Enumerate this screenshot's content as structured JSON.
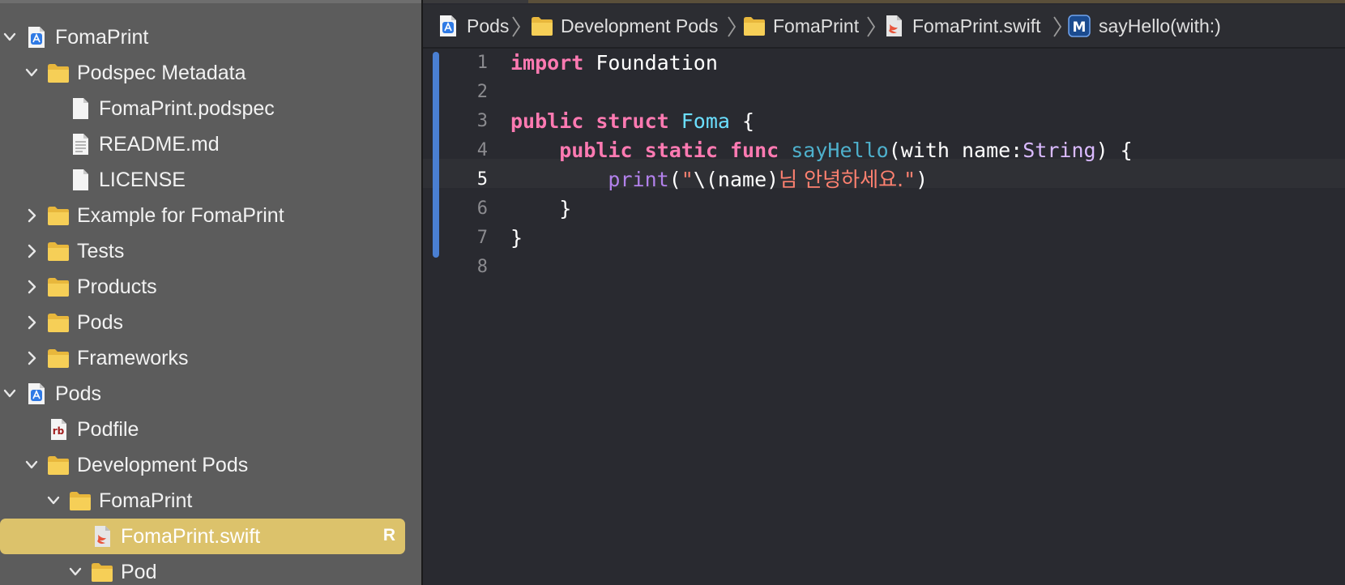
{
  "navigator": {
    "items": [
      {
        "label": "FomaPrint",
        "level": 0,
        "expanded": true,
        "icon": "xcode-project-icon"
      },
      {
        "label": "Podspec Metadata",
        "level": 1,
        "expanded": true,
        "icon": "folder-icon"
      },
      {
        "label": "FomaPrint.podspec",
        "level": 2,
        "icon": "file-icon"
      },
      {
        "label": "README.md",
        "level": 2,
        "icon": "text-file-icon"
      },
      {
        "label": "LICENSE",
        "level": 2,
        "icon": "file-icon"
      },
      {
        "label": "Example for FomaPrint",
        "level": 1,
        "expanded": false,
        "icon": "folder-icon"
      },
      {
        "label": "Tests",
        "level": 1,
        "expanded": false,
        "icon": "folder-icon"
      },
      {
        "label": "Products",
        "level": 1,
        "expanded": false,
        "icon": "folder-icon"
      },
      {
        "label": "Pods",
        "level": 1,
        "expanded": false,
        "icon": "folder-icon"
      },
      {
        "label": "Frameworks",
        "level": 1,
        "expanded": false,
        "icon": "folder-icon"
      },
      {
        "label": "Pods",
        "level": 0,
        "expanded": true,
        "icon": "xcode-project-icon"
      },
      {
        "label": "Podfile",
        "level": 1,
        "icon": "ruby-file-icon",
        "icon_text": "rb"
      },
      {
        "label": "Development Pods",
        "level": 1,
        "expanded": true,
        "icon": "folder-icon"
      },
      {
        "label": "FomaPrint",
        "level": 2,
        "expanded": true,
        "icon": "folder-icon"
      },
      {
        "label": "FomaPrint.swift",
        "level": 3,
        "icon": "swift-file-icon",
        "selected": true,
        "badge": "R"
      },
      {
        "label": "Pod",
        "level": 3,
        "expanded": true,
        "icon": "folder-icon"
      }
    ]
  },
  "jumpbar": {
    "crumbs": [
      {
        "label": "Pods",
        "icon": "xcode-project-icon"
      },
      {
        "label": "Development Pods",
        "icon": "folder-icon"
      },
      {
        "label": "FomaPrint",
        "icon": "folder-icon"
      },
      {
        "label": "FomaPrint.swift",
        "icon": "swift-file-icon"
      },
      {
        "label": "sayHello(with:)",
        "icon": "method-icon",
        "icon_text": "M"
      }
    ]
  },
  "editor": {
    "current_line": 5,
    "lines": [
      {
        "number": "1",
        "tokens": [
          {
            "t": "import",
            "c": "kw"
          },
          {
            "t": " Foundation",
            "c": ""
          }
        ]
      },
      {
        "number": "2",
        "tokens": []
      },
      {
        "number": "3",
        "tokens": [
          {
            "t": "public",
            "c": "kw"
          },
          {
            "t": " ",
            "c": ""
          },
          {
            "t": "struct",
            "c": "kw"
          },
          {
            "t": " ",
            "c": ""
          },
          {
            "t": "Foma",
            "c": "type"
          },
          {
            "t": " {",
            "c": ""
          }
        ]
      },
      {
        "number": "4",
        "tokens": [
          {
            "t": "    ",
            "c": ""
          },
          {
            "t": "public",
            "c": "kw"
          },
          {
            "t": " ",
            "c": ""
          },
          {
            "t": "static",
            "c": "kw"
          },
          {
            "t": " ",
            "c": ""
          },
          {
            "t": "func",
            "c": "kw"
          },
          {
            "t": " ",
            "c": ""
          },
          {
            "t": "sayHello",
            "c": "fn"
          },
          {
            "t": "(with name:",
            "c": ""
          },
          {
            "t": "String",
            "c": "stdtype"
          },
          {
            "t": ") {",
            "c": ""
          }
        ]
      },
      {
        "number": "5",
        "tokens": [
          {
            "t": "        ",
            "c": ""
          },
          {
            "t": "print",
            "c": "callee"
          },
          {
            "t": "(",
            "c": ""
          },
          {
            "t": "\"",
            "c": "str"
          },
          {
            "t": "\\(name)",
            "c": ""
          },
          {
            "t": "님 안녕하세요.",
            "c": "str ko"
          },
          {
            "t": "\"",
            "c": "str"
          },
          {
            "t": ")",
            "c": ""
          }
        ]
      },
      {
        "number": "6",
        "tokens": [
          {
            "t": "    }",
            "c": ""
          }
        ]
      },
      {
        "number": "7",
        "tokens": [
          {
            "t": "}",
            "c": ""
          }
        ]
      },
      {
        "number": "8",
        "tokens": []
      }
    ]
  },
  "colors": {
    "selection": "#dcc26b",
    "keyword": "#ff7ab2",
    "type": "#6bdfff",
    "string": "#ff8170",
    "change_bar": "#4a7fd2"
  }
}
